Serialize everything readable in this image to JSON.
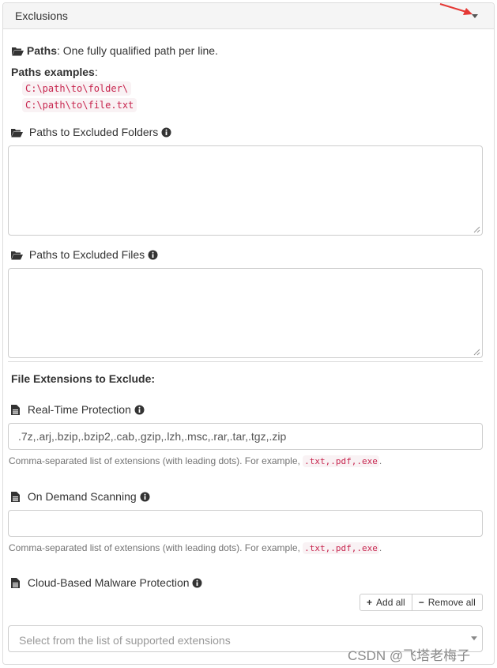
{
  "panel": {
    "title": "Exclusions"
  },
  "paths": {
    "heading_bold": "Paths",
    "heading_rest": ": One fully qualified path per line.",
    "examples_label": "Paths examples",
    "examples_colon": ":",
    "examples": [
      "C:\\path\\to\\folder\\",
      "C:\\path\\to\\file.txt"
    ]
  },
  "excluded_folders": {
    "label": "Paths to Excluded Folders",
    "value": ""
  },
  "excluded_files": {
    "label": "Paths to Excluded Files",
    "value": ""
  },
  "extensions": {
    "heading": "File Extensions to Exclude:",
    "help_prefix": "Comma-separated list of extensions (with leading dots). For example, ",
    "help_code": ".txt,.pdf,.exe",
    "help_suffix": ".",
    "realtime": {
      "label": "Real-Time Protection",
      "value": ".7z,.arj,.bzip,.bzip2,.cab,.gzip,.lzh,.msc,.rar,.tar,.tgz,.zip"
    },
    "ondemand": {
      "label": "On Demand Scanning",
      "value": ""
    },
    "cloud": {
      "label": "Cloud-Based Malware Protection",
      "add_all": "Add all",
      "remove_all": "Remove all",
      "placeholder": "Select from the list of supported extensions"
    }
  },
  "icons": {
    "collapse": "caret-down-icon",
    "folder": "folder-open-icon",
    "file": "file-icon",
    "info": "info-circle-icon",
    "plus": "plus-icon",
    "minus": "minus-icon"
  },
  "colors": {
    "code_text": "#c7254e",
    "code_bg": "#f9f2f4",
    "annotation_arrow": "#e53935",
    "help_text": "#737373"
  },
  "watermark": "CSDN @飞塔老梅子"
}
